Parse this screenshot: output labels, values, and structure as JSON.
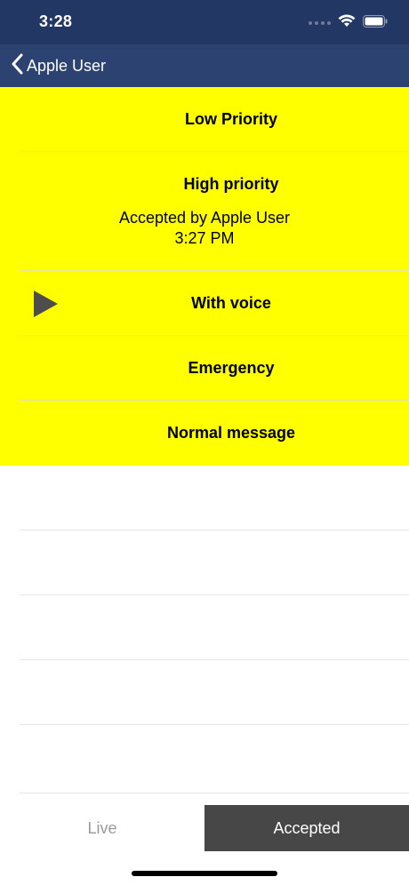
{
  "status_bar": {
    "time": "3:28"
  },
  "nav": {
    "back_label": "Apple User"
  },
  "messages": [
    {
      "title": "Low Priority"
    },
    {
      "title": "High priority",
      "accepted_by": "Accepted by Apple User",
      "accepted_time": "3:27 PM"
    },
    {
      "title": "With voice"
    },
    {
      "title": "Emergency"
    },
    {
      "title": "Normal message"
    }
  ],
  "tabs": {
    "live": "Live",
    "accepted": "Accepted"
  },
  "colors": {
    "status_bar_bg": "#233764",
    "nav_bg": "#2c4271",
    "message_bg": "#ffff00",
    "active_tab_bg": "#474747"
  }
}
